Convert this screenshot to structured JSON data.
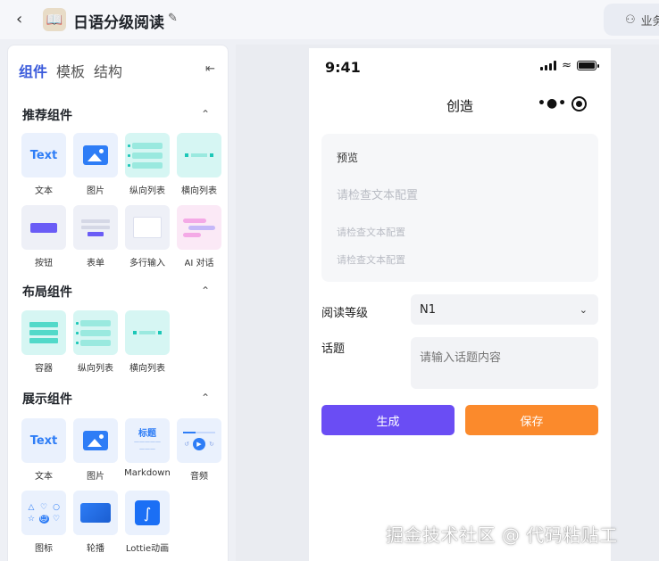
{
  "header": {
    "back_icon": "chevron-left-icon",
    "app_icon": "book-icon",
    "app_title": "日语分级阅读",
    "edit_icon": "edit-icon",
    "biz_label": "业务"
  },
  "sidebar": {
    "tabs": [
      {
        "label": "组件",
        "active": true
      },
      {
        "label": "模板",
        "active": false
      },
      {
        "label": "结构",
        "active": false
      }
    ],
    "sections": [
      {
        "title": "推荐组件",
        "items": [
          {
            "label": "文本"
          },
          {
            "label": "图片"
          },
          {
            "label": "纵向列表"
          },
          {
            "label": "横向列表"
          },
          {
            "label": "按钮"
          },
          {
            "label": "表单"
          },
          {
            "label": "多行输入"
          },
          {
            "label": "AI 对话"
          }
        ]
      },
      {
        "title": "布局组件",
        "items": [
          {
            "label": "容器"
          },
          {
            "label": "纵向列表"
          },
          {
            "label": "横向列表"
          }
        ]
      },
      {
        "title": "展示组件",
        "items": [
          {
            "label": "文本"
          },
          {
            "label": "图片"
          },
          {
            "label": "Markdown"
          },
          {
            "label": "音频"
          },
          {
            "label": "图标"
          },
          {
            "label": "轮播"
          },
          {
            "label": "Lottie动画"
          }
        ]
      }
    ],
    "thumb_text": "Text",
    "thumb_md_title": "标题"
  },
  "phone": {
    "time": "9:41",
    "nav_title": "创造",
    "preview": {
      "label": "预览",
      "heading": "请检查文本配置",
      "line1": "请检查文本配置",
      "line2": "请检查文本配置"
    },
    "level_label": "阅读等级",
    "level_value": "N1",
    "topic_label": "话题",
    "topic_placeholder": "请输入话题内容",
    "generate_label": "生成",
    "save_label": "保存"
  },
  "watermark": "掘金技术社区 @ 代码粘贴工",
  "colors": {
    "accent": "#3b5bdb",
    "generate": "#6a4df4",
    "save": "#fb8a2c"
  }
}
